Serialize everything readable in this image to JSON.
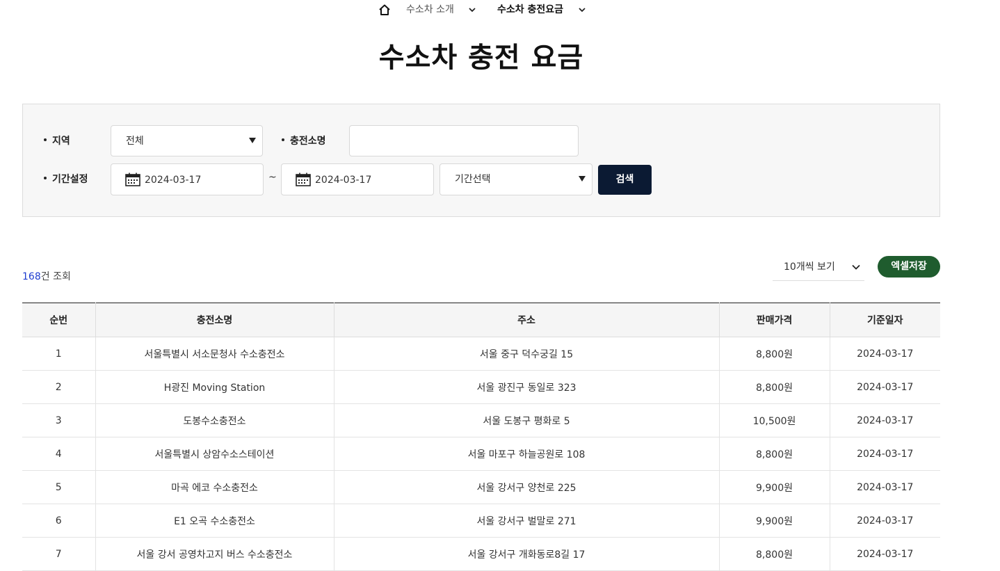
{
  "breadcrumb": {
    "home_icon": "home-icon",
    "items": [
      {
        "label": "수소차 소개"
      },
      {
        "label": "수소차 충전요금"
      }
    ]
  },
  "page": {
    "title": "수소차 충전 요금"
  },
  "search": {
    "region_label": "지역",
    "region_value": "전체",
    "station_label": "충전소명",
    "station_value": "",
    "period_label": "기간설정",
    "start_date": "2024-03-17",
    "date_separator": "~",
    "end_date": "2024-03-17",
    "period_select_value": "기간선택",
    "search_button": "검색"
  },
  "results": {
    "count": "168",
    "count_suffix": "건 조회",
    "per_page_value": "10개씩 보기",
    "excel_button": "엑셀저장",
    "excel_color": "#1f5c2e"
  },
  "table": {
    "columns": [
      "순번",
      "충전소명",
      "주소",
      "판매가격",
      "기준일자"
    ],
    "rows": [
      [
        "1",
        "서울특별시 서소문청사 수소충전소",
        "서울 중구 덕수궁길 15",
        "8,800원",
        "2024-03-17"
      ],
      [
        "2",
        "H광진 Moving Station",
        "서울 광진구 동일로 323",
        "8,800원",
        "2024-03-17"
      ],
      [
        "3",
        "도봉수소충전소",
        "서울 도봉구 평화로 5",
        "10,500원",
        "2024-03-17"
      ],
      [
        "4",
        "서울특별시 상암수소스테이션",
        "서울 마포구 하늘공원로 108",
        "8,800원",
        "2024-03-17"
      ],
      [
        "5",
        "마곡 에코 수소충전소",
        "서울 강서구 양천로 225",
        "9,900원",
        "2024-03-17"
      ],
      [
        "6",
        "E1 오곡 수소충전소",
        "서울 강서구 벌말로 271",
        "9,900원",
        "2024-03-17"
      ],
      [
        "7",
        "서울 강서 공영차고지 버스 수소충전소",
        "서울 강서구 개화동로8길 17",
        "8,800원",
        "2024-03-17"
      ]
    ]
  },
  "colors": {
    "search_button_bg": "#0b1a33",
    "count_highlight": "#1e3dd0"
  }
}
